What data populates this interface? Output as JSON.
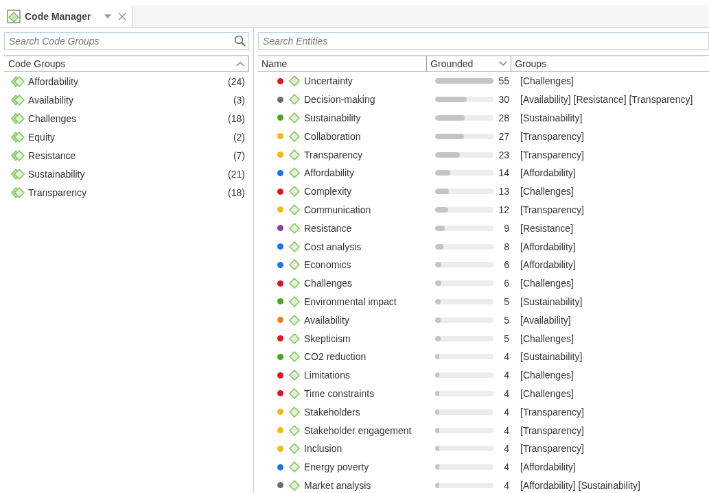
{
  "tab": {
    "title": "Code Manager"
  },
  "code_groups": {
    "search": {
      "placeholder": "Search Code Groups"
    },
    "header": "Code Groups",
    "items": [
      {
        "name": "Affordability",
        "count": "(24)"
      },
      {
        "name": "Availability",
        "count": "(3)"
      },
      {
        "name": "Challenges",
        "count": "(18)"
      },
      {
        "name": "Equity",
        "count": "(2)"
      },
      {
        "name": "Resistance",
        "count": "(7)"
      },
      {
        "name": "Sustainability",
        "count": "(21)"
      },
      {
        "name": "Transparency",
        "count": "(18)"
      }
    ]
  },
  "entities": {
    "search": {
      "placeholder": "Search Entities"
    },
    "columns": [
      "Name",
      "Grounded",
      "Groups"
    ],
    "rows": [
      {
        "name": "Uncertainty",
        "color": "#e0151b",
        "level": 1.0,
        "grounded": "55",
        "groups": "[Challenges]"
      },
      {
        "name": "Decision-making",
        "color": "#6d6d6d",
        "level": 0.545,
        "grounded": "30",
        "groups": "[Availability] [Resistance] [Transparency]"
      },
      {
        "name": "Sustainability",
        "color": "#46a81c",
        "level": 0.51,
        "grounded": "28",
        "groups": "[Sustainability]"
      },
      {
        "name": "Collaboration",
        "color": "#f7b80d",
        "level": 0.49,
        "grounded": "27",
        "groups": "[Transparency]"
      },
      {
        "name": "Transparency",
        "color": "#f7b80d",
        "level": 0.42,
        "grounded": "23",
        "groups": "[Transparency]"
      },
      {
        "name": "Affordability",
        "color": "#1a73e8",
        "level": 0.255,
        "grounded": "14",
        "groups": "[Affordability]"
      },
      {
        "name": "Complexity",
        "color": "#e0151b",
        "level": 0.236,
        "grounded": "13",
        "groups": "[Challenges]"
      },
      {
        "name": "Communication",
        "color": "#f7b80d",
        "level": 0.218,
        "grounded": "12",
        "groups": "[Transparency]"
      },
      {
        "name": "Resistance",
        "color": "#8b3bab",
        "level": 0.164,
        "grounded": "9",
        "groups": "[Resistance]"
      },
      {
        "name": "Cost analysis",
        "color": "#1a73e8",
        "level": 0.145,
        "grounded": "8",
        "groups": "[Affordability]"
      },
      {
        "name": "Economics",
        "color": "#1a73e8",
        "level": 0.109,
        "grounded": "6",
        "groups": "[Affordability]"
      },
      {
        "name": "Challenges",
        "color": "#e0151b",
        "level": 0.109,
        "grounded": "6",
        "groups": "[Challenges]"
      },
      {
        "name": "Environmental impact",
        "color": "#46a81c",
        "level": 0.091,
        "grounded": "5",
        "groups": "[Sustainability]"
      },
      {
        "name": "Availability",
        "color": "#f47b20",
        "level": 0.091,
        "grounded": "5",
        "groups": "[Availability]"
      },
      {
        "name": "Skepticism",
        "color": "#e0151b",
        "level": 0.091,
        "grounded": "5",
        "groups": "[Challenges]"
      },
      {
        "name": "CO2 reduction",
        "color": "#46a81c",
        "level": 0.073,
        "grounded": "4",
        "groups": "[Sustainability]"
      },
      {
        "name": "Limitations",
        "color": "#e0151b",
        "level": 0.073,
        "grounded": "4",
        "groups": "[Challenges]"
      },
      {
        "name": "Time constraints",
        "color": "#e0151b",
        "level": 0.073,
        "grounded": "4",
        "groups": "[Challenges]"
      },
      {
        "name": "Stakeholders",
        "color": "#f7b80d",
        "level": 0.073,
        "grounded": "4",
        "groups": "[Transparency]"
      },
      {
        "name": "Stakeholder engagement",
        "color": "#f7b80d",
        "level": 0.073,
        "grounded": "4",
        "groups": "[Transparency]"
      },
      {
        "name": "Inclusion",
        "color": "#f7b80d",
        "level": 0.073,
        "grounded": "4",
        "groups": "[Transparency]"
      },
      {
        "name": "Energy poverty",
        "color": "#1a73e8",
        "level": 0.073,
        "grounded": "4",
        "groups": "[Affordability]"
      },
      {
        "name": "Market analysis",
        "color": "#6d6d6d",
        "level": 0.073,
        "grounded": "4",
        "groups": "[Affordability] [Sustainability]"
      }
    ]
  }
}
